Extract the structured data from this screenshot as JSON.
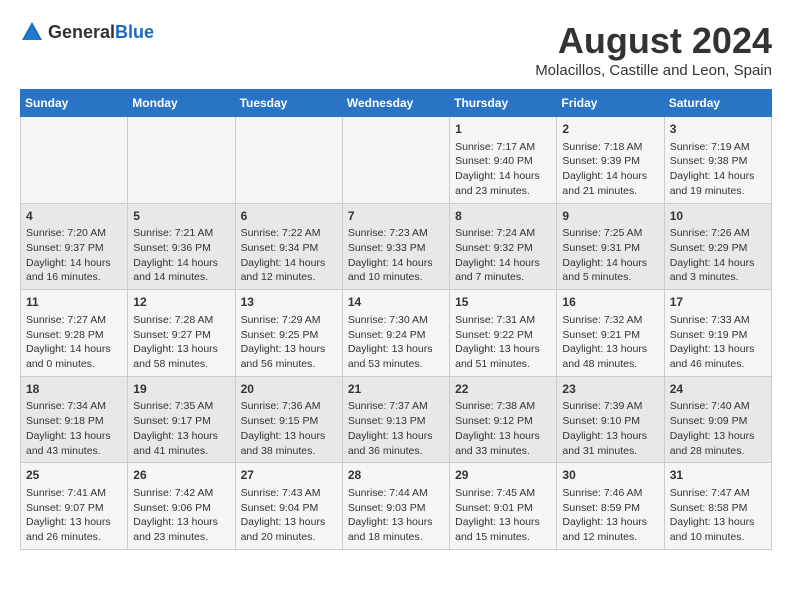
{
  "logo": {
    "text_general": "General",
    "text_blue": "Blue"
  },
  "header": {
    "month_year": "August 2024",
    "location": "Molacillos, Castille and Leon, Spain"
  },
  "days_of_week": [
    "Sunday",
    "Monday",
    "Tuesday",
    "Wednesday",
    "Thursday",
    "Friday",
    "Saturday"
  ],
  "weeks": [
    [
      {
        "day": "",
        "content": ""
      },
      {
        "day": "",
        "content": ""
      },
      {
        "day": "",
        "content": ""
      },
      {
        "day": "",
        "content": ""
      },
      {
        "day": "1",
        "content": "Sunrise: 7:17 AM\nSunset: 9:40 PM\nDaylight: 14 hours\nand 23 minutes."
      },
      {
        "day": "2",
        "content": "Sunrise: 7:18 AM\nSunset: 9:39 PM\nDaylight: 14 hours\nand 21 minutes."
      },
      {
        "day": "3",
        "content": "Sunrise: 7:19 AM\nSunset: 9:38 PM\nDaylight: 14 hours\nand 19 minutes."
      }
    ],
    [
      {
        "day": "4",
        "content": "Sunrise: 7:20 AM\nSunset: 9:37 PM\nDaylight: 14 hours\nand 16 minutes."
      },
      {
        "day": "5",
        "content": "Sunrise: 7:21 AM\nSunset: 9:36 PM\nDaylight: 14 hours\nand 14 minutes."
      },
      {
        "day": "6",
        "content": "Sunrise: 7:22 AM\nSunset: 9:34 PM\nDaylight: 14 hours\nand 12 minutes."
      },
      {
        "day": "7",
        "content": "Sunrise: 7:23 AM\nSunset: 9:33 PM\nDaylight: 14 hours\nand 10 minutes."
      },
      {
        "day": "8",
        "content": "Sunrise: 7:24 AM\nSunset: 9:32 PM\nDaylight: 14 hours\nand 7 minutes."
      },
      {
        "day": "9",
        "content": "Sunrise: 7:25 AM\nSunset: 9:31 PM\nDaylight: 14 hours\nand 5 minutes."
      },
      {
        "day": "10",
        "content": "Sunrise: 7:26 AM\nSunset: 9:29 PM\nDaylight: 14 hours\nand 3 minutes."
      }
    ],
    [
      {
        "day": "11",
        "content": "Sunrise: 7:27 AM\nSunset: 9:28 PM\nDaylight: 14 hours\nand 0 minutes."
      },
      {
        "day": "12",
        "content": "Sunrise: 7:28 AM\nSunset: 9:27 PM\nDaylight: 13 hours\nand 58 minutes."
      },
      {
        "day": "13",
        "content": "Sunrise: 7:29 AM\nSunset: 9:25 PM\nDaylight: 13 hours\nand 56 minutes."
      },
      {
        "day": "14",
        "content": "Sunrise: 7:30 AM\nSunset: 9:24 PM\nDaylight: 13 hours\nand 53 minutes."
      },
      {
        "day": "15",
        "content": "Sunrise: 7:31 AM\nSunset: 9:22 PM\nDaylight: 13 hours\nand 51 minutes."
      },
      {
        "day": "16",
        "content": "Sunrise: 7:32 AM\nSunset: 9:21 PM\nDaylight: 13 hours\nand 48 minutes."
      },
      {
        "day": "17",
        "content": "Sunrise: 7:33 AM\nSunset: 9:19 PM\nDaylight: 13 hours\nand 46 minutes."
      }
    ],
    [
      {
        "day": "18",
        "content": "Sunrise: 7:34 AM\nSunset: 9:18 PM\nDaylight: 13 hours\nand 43 minutes."
      },
      {
        "day": "19",
        "content": "Sunrise: 7:35 AM\nSunset: 9:17 PM\nDaylight: 13 hours\nand 41 minutes."
      },
      {
        "day": "20",
        "content": "Sunrise: 7:36 AM\nSunset: 9:15 PM\nDaylight: 13 hours\nand 38 minutes."
      },
      {
        "day": "21",
        "content": "Sunrise: 7:37 AM\nSunset: 9:13 PM\nDaylight: 13 hours\nand 36 minutes."
      },
      {
        "day": "22",
        "content": "Sunrise: 7:38 AM\nSunset: 9:12 PM\nDaylight: 13 hours\nand 33 minutes."
      },
      {
        "day": "23",
        "content": "Sunrise: 7:39 AM\nSunset: 9:10 PM\nDaylight: 13 hours\nand 31 minutes."
      },
      {
        "day": "24",
        "content": "Sunrise: 7:40 AM\nSunset: 9:09 PM\nDaylight: 13 hours\nand 28 minutes."
      }
    ],
    [
      {
        "day": "25",
        "content": "Sunrise: 7:41 AM\nSunset: 9:07 PM\nDaylight: 13 hours\nand 26 minutes."
      },
      {
        "day": "26",
        "content": "Sunrise: 7:42 AM\nSunset: 9:06 PM\nDaylight: 13 hours\nand 23 minutes."
      },
      {
        "day": "27",
        "content": "Sunrise: 7:43 AM\nSunset: 9:04 PM\nDaylight: 13 hours\nand 20 minutes."
      },
      {
        "day": "28",
        "content": "Sunrise: 7:44 AM\nSunset: 9:03 PM\nDaylight: 13 hours\nand 18 minutes."
      },
      {
        "day": "29",
        "content": "Sunrise: 7:45 AM\nSunset: 9:01 PM\nDaylight: 13 hours\nand 15 minutes."
      },
      {
        "day": "30",
        "content": "Sunrise: 7:46 AM\nSunset: 8:59 PM\nDaylight: 13 hours\nand 12 minutes."
      },
      {
        "day": "31",
        "content": "Sunrise: 7:47 AM\nSunset: 8:58 PM\nDaylight: 13 hours\nand 10 minutes."
      }
    ]
  ]
}
